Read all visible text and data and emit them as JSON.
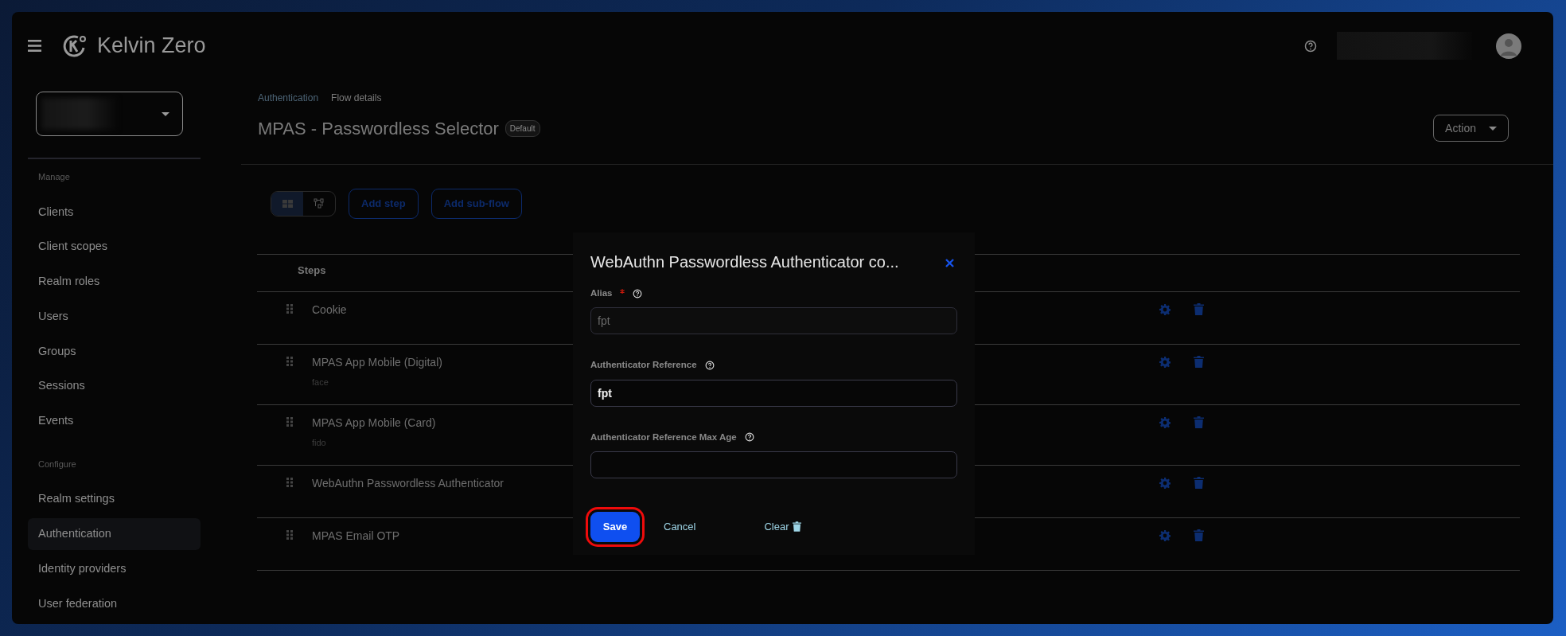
{
  "header": {
    "brand": "Kelvin Zero"
  },
  "sidebar": {
    "sections": [
      {
        "heading": "Manage",
        "items": [
          {
            "label": "Clients",
            "selected": false
          },
          {
            "label": "Client scopes",
            "selected": false
          },
          {
            "label": "Realm roles",
            "selected": false
          },
          {
            "label": "Users",
            "selected": false
          },
          {
            "label": "Groups",
            "selected": false
          },
          {
            "label": "Sessions",
            "selected": false
          },
          {
            "label": "Events",
            "selected": false
          }
        ]
      },
      {
        "heading": "Configure",
        "items": [
          {
            "label": "Realm settings",
            "selected": false
          },
          {
            "label": "Authentication",
            "selected": true
          },
          {
            "label": "Identity providers",
            "selected": false
          },
          {
            "label": "User federation",
            "selected": false
          }
        ]
      }
    ]
  },
  "breadcrumb": [
    "Authentication",
    "Flow details"
  ],
  "page": {
    "title": "MPAS - Passwordless Selector",
    "badge": "Default",
    "action": "Action"
  },
  "toolbar": {
    "views": [
      {
        "kind": "table",
        "selected": true
      },
      {
        "kind": "diagram",
        "selected": false
      }
    ],
    "buttons": [
      "Add step",
      "Add sub-flow"
    ]
  },
  "table": {
    "columns": [
      "Steps"
    ],
    "rows": [
      {
        "name": "Cookie"
      },
      {
        "name": "MPAS App Mobile (Digital)",
        "alias": "face"
      },
      {
        "name": "MPAS App Mobile (Card)",
        "alias": "fido"
      },
      {
        "name": "WebAuthn Passwordless Authenticator"
      },
      {
        "name": "MPAS Email OTP"
      }
    ]
  },
  "modal": {
    "title": "WebAuthn Passwordless Authenticator co...",
    "fields": [
      {
        "label": "Alias",
        "required": true,
        "disabled": true,
        "value": "fpt"
      },
      {
        "label": "Authenticator Reference",
        "required": false,
        "disabled": false,
        "value": "fpt"
      },
      {
        "label": "Authenticator Reference Max Age",
        "required": false,
        "disabled": false
      }
    ],
    "buttons": [
      {
        "label": "Save",
        "kind": "primary",
        "highlighted": true
      },
      {
        "label": "Cancel",
        "kind": "link"
      },
      {
        "label": "Clear",
        "kind": "clear"
      }
    ]
  }
}
